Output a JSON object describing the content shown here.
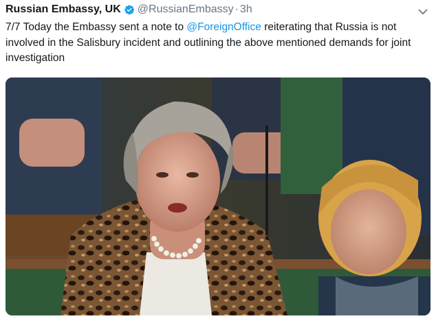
{
  "tweet": {
    "display_name": "Russian Embassy, UK",
    "handle": "@RussianEmbassy",
    "separator": "·",
    "time": "3h",
    "text_before": "7/7 Today the Embassy sent a note to ",
    "mention": "@ForeignOffice",
    "text_after": " reiterating that Russia is not involved in the Salisbury incident and outlining the above mentioned demands for joint investigation"
  },
  "colors": {
    "verified_badge": "#1da1f2",
    "mention": "#1b95e0",
    "secondary_text": "#657786"
  },
  "icons": {
    "verified": "verified-badge-icon",
    "menu": "chevron-down-icon"
  }
}
